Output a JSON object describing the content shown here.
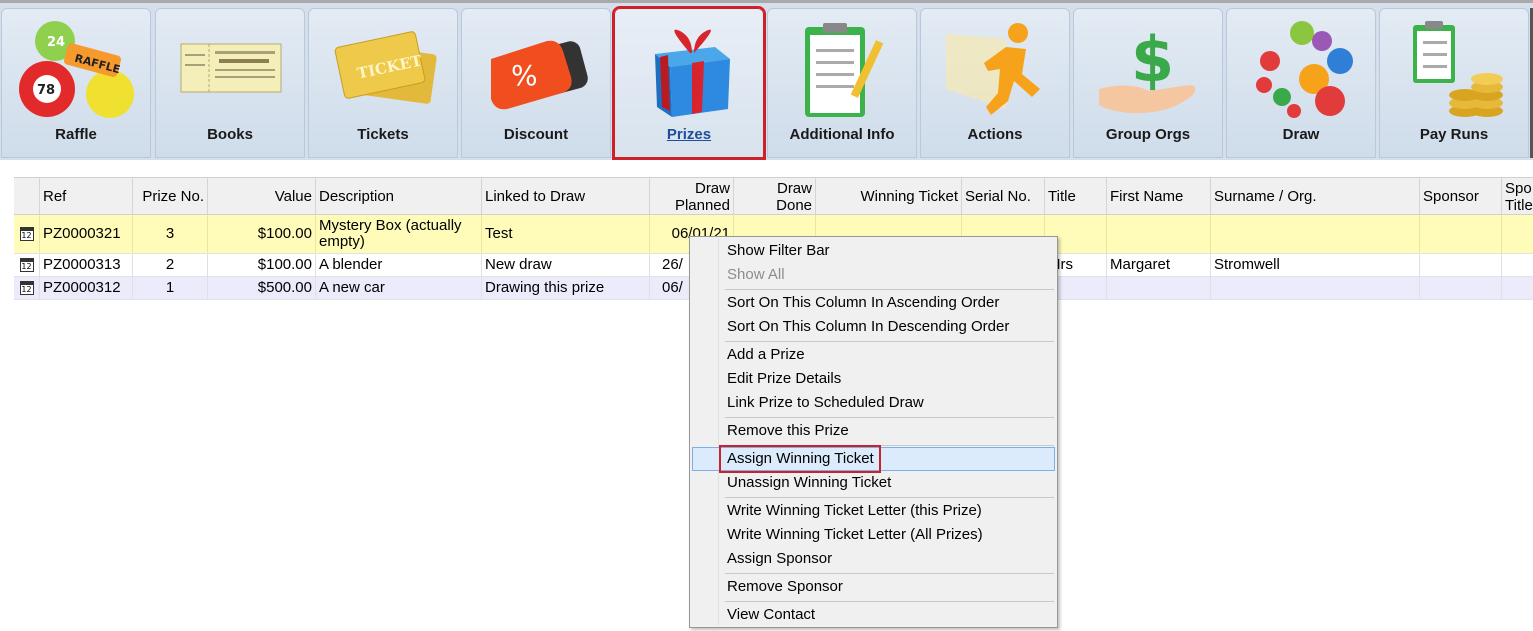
{
  "ribbon": {
    "buttons": [
      {
        "label": "Raffle",
        "icon": "raffle-balls-icon"
      },
      {
        "label": "Books",
        "icon": "book-ticket-icon"
      },
      {
        "label": "Tickets",
        "icon": "tickets-icon"
      },
      {
        "label": "Discount",
        "icon": "discount-tag-icon"
      },
      {
        "label": "Prizes",
        "icon": "gift-box-icon",
        "active": true
      },
      {
        "label": "Additional Info",
        "icon": "clipboard-pencil-icon"
      },
      {
        "label": "Actions",
        "icon": "running-man-icon"
      },
      {
        "label": "Group Orgs",
        "icon": "hand-dollar-icon"
      },
      {
        "label": "Draw",
        "icon": "lottery-balls-icon"
      },
      {
        "label": "Pay Runs",
        "icon": "checklist-coins-icon"
      }
    ]
  },
  "grid": {
    "headers": {
      "ref": "Ref",
      "prize_no": "Prize No.",
      "value": "Value",
      "description": "Description",
      "linked": "Linked to Draw",
      "draw_planned": "Draw Planned",
      "draw_done": "Draw Done",
      "winning_ticket": "Winning Ticket",
      "serial": "Serial No.",
      "title": "Title",
      "first_name": "First Name",
      "surname": "Surname / Org.",
      "sponsor": "Sponsor",
      "sponsor_title": "Spo Title"
    },
    "rows": [
      {
        "ref": "PZ0000321",
        "prize_no": "3",
        "value": "$100.00",
        "description": "Mystery Box (actually empty)",
        "linked": "Test",
        "draw_planned": "06/01/21",
        "title": "",
        "first_name": "",
        "surname": ""
      },
      {
        "ref": "PZ0000313",
        "prize_no": "2",
        "value": "$100.00",
        "description": "A blender",
        "linked": "New draw",
        "draw_planned": "26/",
        "title": "Mrs",
        "first_name": "Margaret",
        "surname": "Stromwell"
      },
      {
        "ref": "PZ0000312",
        "prize_no": "1",
        "value": "$500.00",
        "description": "A new car",
        "linked": "Drawing this prize",
        "draw_planned": "06/",
        "title": "",
        "first_name": "",
        "surname": ""
      }
    ],
    "calendar_icon_text": "12"
  },
  "context_menu": {
    "items": [
      "Show Filter Bar",
      "Show All",
      "Sort On This Column In Ascending Order",
      "Sort On This Column In Descending Order",
      "Add a Prize",
      "Edit Prize Details",
      "Link Prize to Scheduled Draw",
      "Remove this Prize",
      "Assign Winning Ticket",
      "Unassign Winning Ticket",
      "Write Winning Ticket Letter (this Prize)",
      "Write Winning Ticket Letter (All Prizes)",
      "Assign Sponsor",
      "Remove Sponsor",
      "View Contact"
    ],
    "disabled_item": "Show All",
    "highlighted_item": "Assign Winning Ticket"
  },
  "colors": {
    "ribbon_bg": "#d4dfeb",
    "active_outline": "#cf2027",
    "selected_row": "#fffbb8",
    "alt_row": "#ebebfb",
    "menu_hot": "#dcebfc"
  }
}
